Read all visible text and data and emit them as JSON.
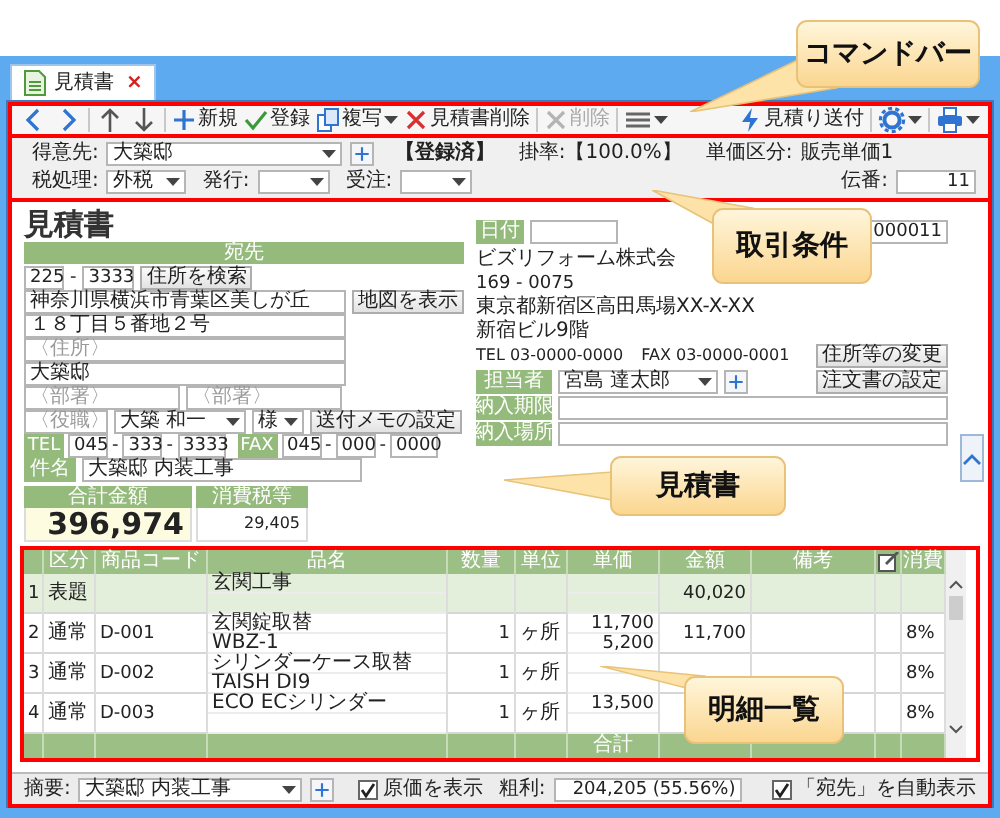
{
  "tab": {
    "title": "見積書",
    "close": "×",
    "selected": true
  },
  "command_bar": {
    "items": [
      {
        "kind": "icon",
        "disabled": false
      },
      {
        "kind": "icon",
        "disabled": false
      },
      {
        "kind": "separator"
      },
      {
        "kind": "icon",
        "disabled": false
      },
      {
        "kind": "icon",
        "disabled": false
      },
      {
        "kind": "separator"
      },
      {
        "kind": "button",
        "label": "新規",
        "disabled": false
      },
      {
        "kind": "button",
        "label": "登録",
        "disabled": false
      },
      {
        "kind": "split",
        "label": "複写",
        "disabled": false
      },
      {
        "kind": "button",
        "label": "見積書削除",
        "disabled": false
      },
      {
        "kind": "separator"
      },
      {
        "kind": "button",
        "label": "削除",
        "disabled": true
      },
      {
        "kind": "separator"
      },
      {
        "kind": "menu",
        "disabled": false
      },
      {
        "kind": "spacer"
      },
      {
        "kind": "button",
        "label": "見積り送付",
        "disabled": false
      },
      {
        "kind": "separator"
      },
      {
        "kind": "menu",
        "disabled": false
      },
      {
        "kind": "separator"
      },
      {
        "kind": "menu",
        "disabled": false
      }
    ]
  },
  "conditions": {
    "customer": {
      "label": "得意先:",
      "value": "大築邸"
    },
    "registered": "【登録済】",
    "rate": "掛率:【100.0%】",
    "price_class": {
      "label": "単価区分:",
      "value": "販売単価1"
    },
    "tax": {
      "label": "税処理:",
      "value": "外税"
    },
    "issue": {
      "label": "発行:"
    },
    "order": {
      "label": "受注:"
    },
    "slip": {
      "label": "伝番:",
      "value": "11"
    }
  },
  "document": {
    "title": "見積書",
    "recipient": {
      "header": "宛先",
      "zip": [
        {
          "kind": "field",
          "text": "225"
        },
        {
          "kind": "sep",
          "text": "-"
        },
        {
          "kind": "field",
          "text": "3333"
        }
      ],
      "search_button": "住所を検索",
      "address1": "神奈川県横浜市青葉区美しが丘",
      "map_button": "地図を表示",
      "address2": "１８丁目５番地２号",
      "address3": {
        "placeholder": "〈住所〉"
      },
      "name": "大築邸",
      "departments": [
        {
          "placeholder": "〈部署〉"
        },
        {
          "placeholder": "〈部署〉"
        }
      ],
      "position": {
        "placeholder": "〈役職〉"
      },
      "person": "大築 和一",
      "honorific": "様",
      "memo_button": "送付メモの設定",
      "tel": {
        "label": "TEL",
        "parts": [
          {
            "kind": "field",
            "text": "045"
          },
          {
            "kind": "sep",
            "text": "-"
          },
          {
            "kind": "field",
            "text": "333"
          },
          {
            "kind": "sep",
            "text": "-"
          },
          {
            "kind": "field",
            "text": "3333"
          }
        ]
      },
      "fax": {
        "label": "FAX",
        "parts": [
          {
            "kind": "field",
            "text": "045"
          },
          {
            "kind": "sep",
            "text": "-"
          },
          {
            "kind": "field",
            "text": "000"
          },
          {
            "kind": "sep",
            "text": "-"
          },
          {
            "kind": "field",
            "text": "0000"
          }
        ]
      },
      "subject": {
        "label": "件名",
        "value": "大築邸 内装工事"
      }
    },
    "issuer": {
      "date_label": "日付",
      "number": "000011",
      "company": "ビズリフォーム株式会",
      "zip": "169 - 0075",
      "address": "東京都新宿区高田馬場XX-X-XX",
      "building": "新宿ビル9階",
      "tel": "TEL 03-0000-0000",
      "fax": "FAX 03-0000-0001",
      "change_button": "住所等の変更",
      "staff_label": "担当者",
      "staff": "宮島 達太郎",
      "order_button": "注文書の設定",
      "delivery": [
        {
          "label": "納入期限"
        },
        {
          "label": "納入場所"
        }
      ]
    },
    "totals": {
      "total_label": "合計金額",
      "total": "396,974",
      "tax_label": "消費税等",
      "tax": "29,405"
    }
  },
  "detail": {
    "columns": [
      {
        "kind": "text"
      },
      {
        "kind": "text",
        "label": "区分"
      },
      {
        "kind": "text",
        "label": "商品コード"
      },
      {
        "kind": "text",
        "label": "品名"
      },
      {
        "kind": "text",
        "label": "数量"
      },
      {
        "kind": "text",
        "label": "単位"
      },
      {
        "kind": "text",
        "label": "単価"
      },
      {
        "kind": "text",
        "label": "金額"
      },
      {
        "kind": "text",
        "label": "備考"
      },
      {
        "kind": "icon"
      },
      {
        "kind": "text",
        "label": "消費"
      }
    ],
    "rows": [
      {
        "kind": "heading",
        "no": "1",
        "category": "表題",
        "name": [
          "玄関工事"
        ],
        "amount": "40,020"
      },
      {
        "kind": "item",
        "no": "2",
        "category": "通常",
        "code": "D-001",
        "name": [
          "玄関錠取替",
          "WBZ-1"
        ],
        "qty": "1",
        "unit": "ヶ所",
        "price": [
          "11,700",
          "5,200"
        ],
        "amount": "11,700",
        "tax": "8%"
      },
      {
        "kind": "item",
        "no": "3",
        "category": "通常",
        "code": "D-002",
        "name": [
          "シリンダーケース取替",
          "TAISH DI9"
        ],
        "qty": "1",
        "unit": "ヶ所",
        "tax": "8%"
      },
      {
        "kind": "item",
        "no": "4",
        "category": "通常",
        "code": "D-003",
        "name": [
          "ECO ECシリンダー"
        ],
        "qty": "1",
        "unit": "ヶ所",
        "price": [
          "13,500"
        ],
        "tax": "8%"
      }
    ],
    "footer_label": "合計"
  },
  "footer": {
    "summary": {
      "label": "摘要:",
      "value": "大築邸 内装工事"
    },
    "show_cost": {
      "label": "原価を表示",
      "checked": true
    },
    "gross_profit": {
      "label": "粗利:",
      "value": "204,205 (55.56%)"
    },
    "auto_recipient": {
      "label": "「宛先」を自動表示",
      "checked": true
    }
  },
  "callouts": [
    {
      "text": "コマンドバー"
    },
    {
      "text": "取引条件"
    },
    {
      "text": "見積書"
    },
    {
      "text": "明細一覧"
    }
  ]
}
